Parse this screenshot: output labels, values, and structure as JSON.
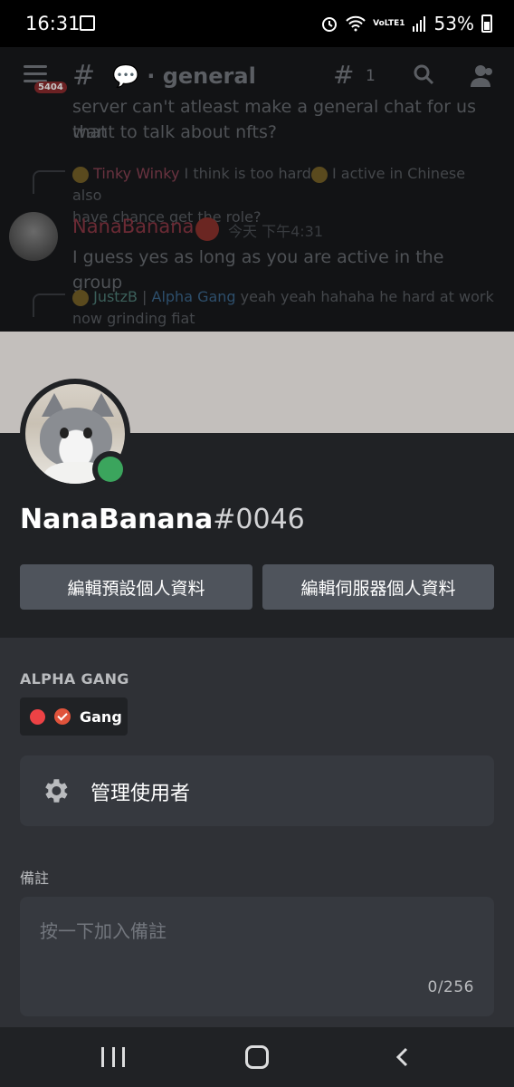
{
  "status_bar": {
    "time": "16:31",
    "battery": "53%",
    "network": "VoLTE1"
  },
  "chat": {
    "badge": "5404",
    "channel_name": "general",
    "thread_count": "1",
    "lines": [
      "server can't atleast make a general chat for us that",
      "want to talk about nfts?"
    ],
    "reply1": {
      "name": "Tinky Winky",
      "text": " I think is too hard",
      "text2": " I active in Chinese also",
      "text3": "have chance get the role?"
    },
    "message": {
      "author": "NanaBanana",
      "time": "今天 下午4:31",
      "text": "I guess yes as long as you are active in the group"
    },
    "reply2": {
      "name": "JustzB",
      "separator": " | ",
      "tag": "Alpha Gang",
      "text": " yeah yeah hahaha he hard at work",
      "text2": "now grinding fiat"
    }
  },
  "profile": {
    "username": "NanaBanana",
    "discriminator": "#0046",
    "status": "online",
    "buttons": {
      "edit_default": "編輯預設個人資料",
      "edit_server": "編輯伺服器個人資料"
    },
    "server_name": "ALPHA GANG",
    "roles": [
      {
        "name": "Gang",
        "color": "#ed4245"
      }
    ],
    "manage_label": "管理使用者",
    "note_label": "備註",
    "note_placeholder": "按一下加入備註",
    "note_count": "0/256"
  },
  "colors": {
    "banner": "#c3bfbc",
    "online": "#3ba55d",
    "button": "#4f545c",
    "sheet": "#2f3136"
  },
  "icons": [
    "image-icon",
    "alarm-icon",
    "wifi-icon",
    "signal-icon",
    "battery-icon",
    "menu-icon",
    "hash-icon",
    "threads-icon",
    "search-icon",
    "members-icon",
    "gear-icon",
    "recents-icon",
    "home-icon",
    "back-icon"
  ]
}
